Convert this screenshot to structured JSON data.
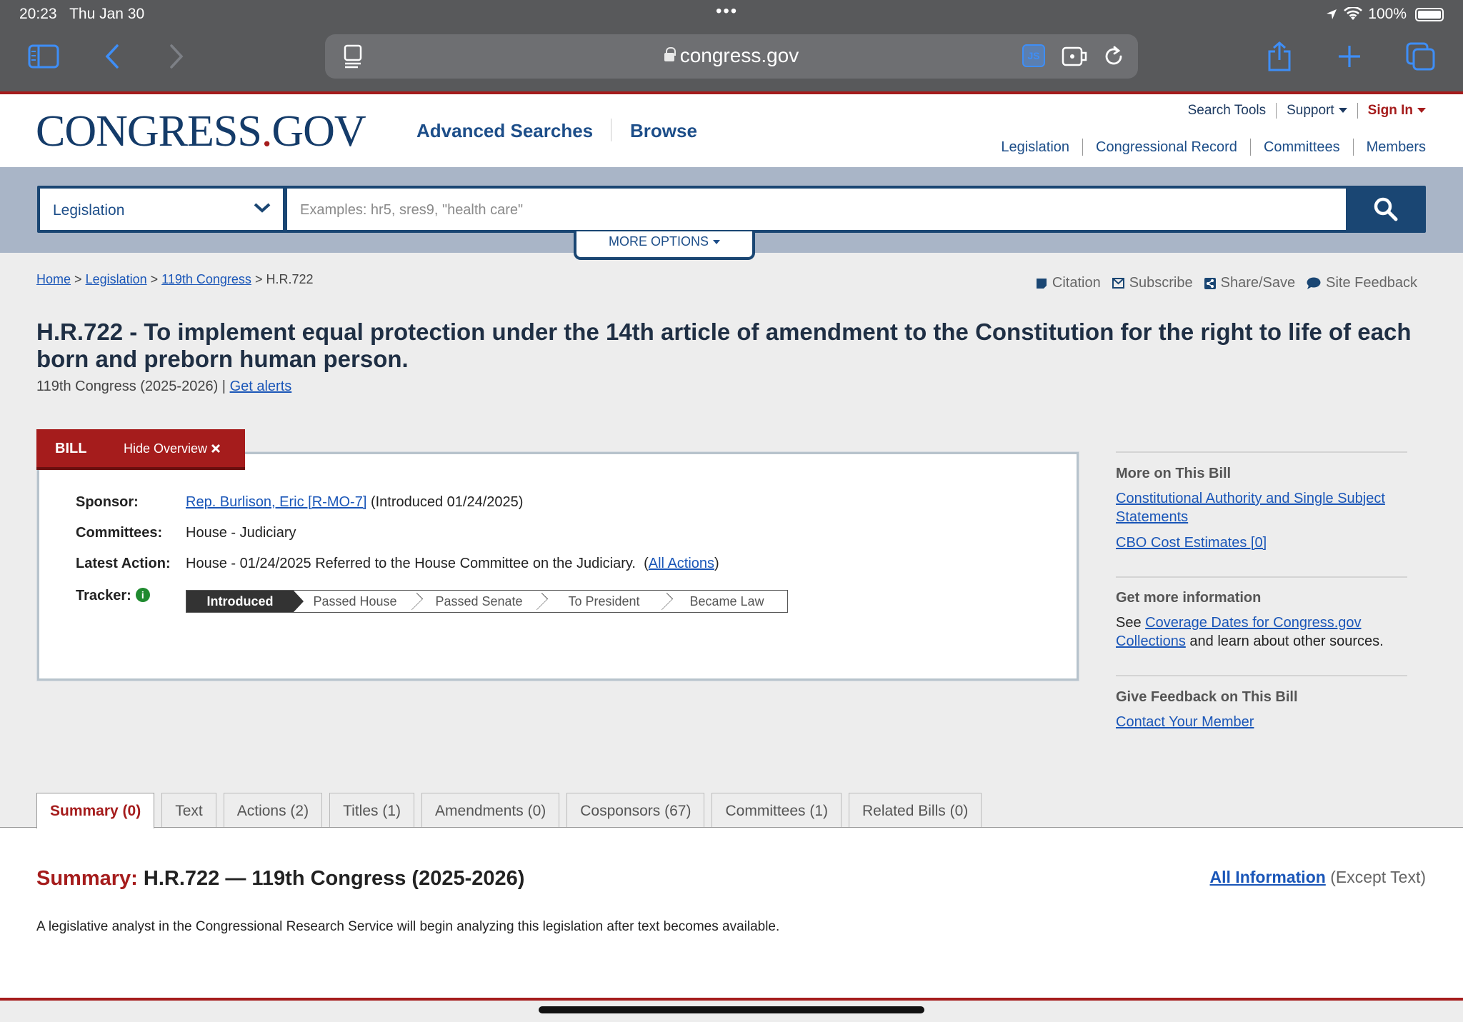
{
  "status": {
    "time": "20:23",
    "date": "Thu Jan 30",
    "battery": "100%"
  },
  "browser": {
    "url": "congress.gov",
    "js_badge": "JS"
  },
  "site": {
    "logo_main": "CONGRESS",
    "logo_dot": ".",
    "logo_tail": "GOV",
    "nav_primary": [
      "Advanced Searches",
      "Browse"
    ],
    "top_links": [
      "Search Tools",
      "Support",
      "Sign In"
    ],
    "sub_links": [
      "Legislation",
      "Congressional Record",
      "Committees",
      "Members"
    ]
  },
  "search": {
    "collection": "Legislation",
    "placeholder": "Examples: hr5, sres9, \"health care\"",
    "more_options": "MORE OPTIONS"
  },
  "breadcrumb": {
    "home": "Home",
    "legislation": "Legislation",
    "congress": "119th Congress",
    "current": "H.R.722",
    "sep": ">"
  },
  "tools": [
    "Citation",
    "Subscribe",
    "Share/Save",
    "Site Feedback"
  ],
  "bill": {
    "title": "H.R.722 - To implement equal protection under the 14th article of amendment to the Constitution for the right to life of each born and preborn human person.",
    "congress": "119th Congress (2025-2026) |",
    "get_alerts": "Get alerts",
    "tab_label": "BILL",
    "hide_overview": "Hide Overview",
    "sponsor_label": "Sponsor:",
    "sponsor_name": "Rep. Burlison, Eric [R-MO-7]",
    "sponsor_intro": "(Introduced 01/24/2025)",
    "committees_label": "Committees:",
    "committees_value": "House - Judiciary",
    "latest_label": "Latest Action:",
    "latest_value": "House - 01/24/2025 Referred to the House Committee on the Judiciary.",
    "all_actions": "All Actions",
    "tracker_label": "Tracker:",
    "tracker_steps": [
      "Introduced",
      "Passed House",
      "Passed Senate",
      "To President",
      "Became Law"
    ],
    "tracker_current": "Introduced"
  },
  "sidebar": {
    "more_heading": "More on This Bill",
    "more_link1": "Constitutional Authority and Single Subject Statements",
    "more_link2": "CBO Cost Estimates [0]",
    "info_heading": "Get more information",
    "info_pre": "See",
    "info_link": "Coverage Dates for Congress.gov Collections",
    "info_post": "and learn about other sources.",
    "feedback_heading": "Give Feedback on This Bill",
    "feedback_link": "Contact Your Member"
  },
  "tabs": [
    "Summary (0)",
    "Text",
    "Actions (2)",
    "Titles (1)",
    "Amendments (0)",
    "Cosponsors (67)",
    "Committees (1)",
    "Related Bills (0)"
  ],
  "summary": {
    "label": "Summary:",
    "heading": "H.R.722 — 119th Congress (2025-2026)",
    "all_info": "All Information",
    "all_info_note": "(Except Text)",
    "text": "A legislative analyst in the Congressional Research Service will begin analyzing this legislation after text becomes available."
  },
  "colors": {
    "brand_red": "#a51c1c",
    "brand_navy": "#1a4673",
    "link": "#1a56b8"
  }
}
